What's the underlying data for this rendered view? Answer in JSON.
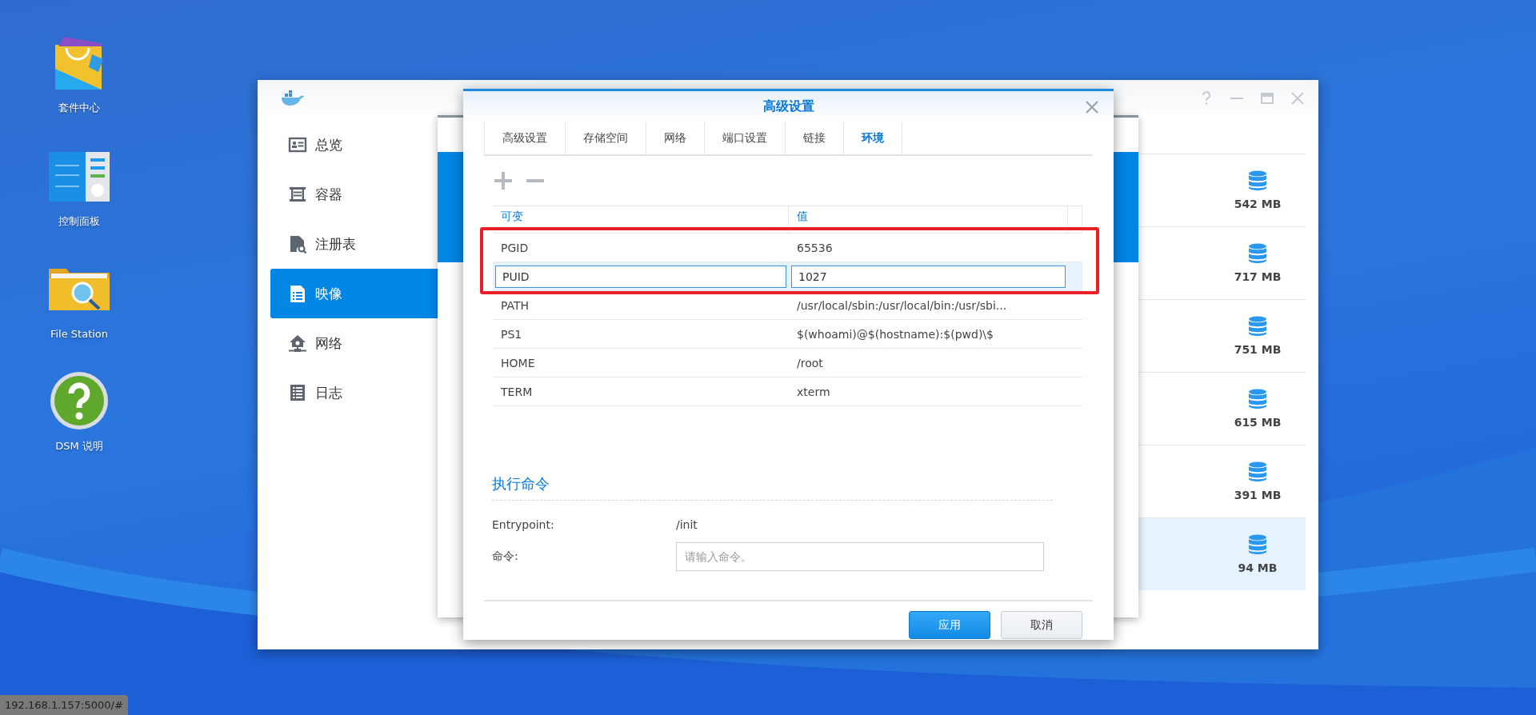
{
  "desktop_icons": [
    {
      "label": "套件中心"
    },
    {
      "label": "控制面板"
    },
    {
      "label": "File Station"
    },
    {
      "label": "DSM 说明"
    }
  ],
  "main_window": {
    "sidebar": [
      {
        "label": "总览",
        "selected": false
      },
      {
        "label": "容器",
        "selected": false
      },
      {
        "label": "注册表",
        "selected": false
      },
      {
        "label": "映像",
        "selected": true
      },
      {
        "label": "网络",
        "selected": false
      },
      {
        "label": "日志",
        "selected": false
      }
    ],
    "image_sizes": [
      {
        "size": "542 MB",
        "selected": false
      },
      {
        "size": "717 MB",
        "selected": false
      },
      {
        "size": "751 MB",
        "selected": false
      },
      {
        "size": "615 MB",
        "selected": false
      },
      {
        "size": "391 MB",
        "selected": false
      },
      {
        "size": "94 MB",
        "selected": true
      }
    ]
  },
  "dialog": {
    "title": "高级设置",
    "tabs": [
      {
        "label": "高级设置",
        "selected": false
      },
      {
        "label": "存储空间",
        "selected": false
      },
      {
        "label": "网络",
        "selected": false
      },
      {
        "label": "端口设置",
        "selected": false
      },
      {
        "label": "链接",
        "selected": false
      },
      {
        "label": "环境",
        "selected": true
      }
    ],
    "table": {
      "columns": [
        "可变",
        "值"
      ],
      "rows": [
        {
          "variable": "PGID",
          "value": "65536",
          "selected": false
        },
        {
          "variable": "PUID",
          "value": "1027",
          "selected": true
        },
        {
          "variable": "PATH",
          "value": "/usr/local/sbin:/usr/local/bin:/usr/sbi...",
          "selected": false
        },
        {
          "variable": "PS1",
          "value": "$(whoami)@$(hostname):$(pwd)\\$",
          "selected": false
        },
        {
          "variable": "HOME",
          "value": "/root",
          "selected": false
        },
        {
          "variable": "TERM",
          "value": "xterm",
          "selected": false
        }
      ]
    },
    "section_title": "执行命令",
    "entrypoint": {
      "label": "Entrypoint:",
      "value": "/init"
    },
    "command": {
      "label": "命令:",
      "placeholder": "请输入命令。"
    },
    "buttons": [
      {
        "label": "应用",
        "kind": "primary"
      },
      {
        "label": "取消",
        "kind": "secondary"
      }
    ]
  },
  "status_bar": "192.168.1.157:5000/#"
}
